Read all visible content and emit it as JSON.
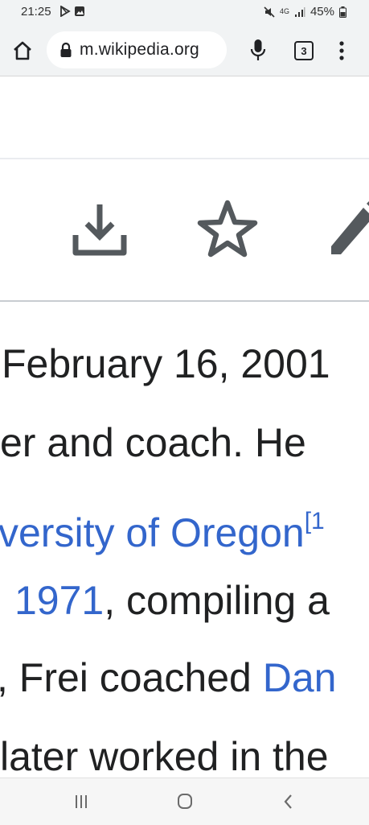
{
  "status_bar": {
    "time": "21:25",
    "network": "4G",
    "battery": "45%",
    "icons": [
      "play-store-icon",
      "image-notification-icon",
      "mute-icon",
      "signal-icon",
      "battery-icon"
    ]
  },
  "browser": {
    "url": "m.wikipedia.org",
    "tab_count": "3",
    "icons": [
      "home-icon",
      "lock-icon",
      "microphone-icon",
      "tabs-icon",
      "overflow-menu-icon"
    ]
  },
  "page_actions": {
    "icons": [
      "download-icon",
      "star-icon",
      "edit-pencil-icon"
    ]
  },
  "article": {
    "line1": "February 16, 2001",
    "line2": "er and coach. He",
    "line3_link": "versity of Oregon",
    "line3_sup": "[1",
    "line4_link": "1971",
    "line4_text": ", compiling a",
    "line5_text": ", Frei coached ",
    "line5_link": "Dan",
    "line6": "later worked in the"
  },
  "colors": {
    "link": "#3366cc",
    "text": "#202122",
    "toolbar": "#f1f3f4",
    "icon_gray": "#54595d"
  },
  "nav_bar": {
    "icons": [
      "recent-apps-icon",
      "home-button-icon",
      "back-icon"
    ]
  }
}
